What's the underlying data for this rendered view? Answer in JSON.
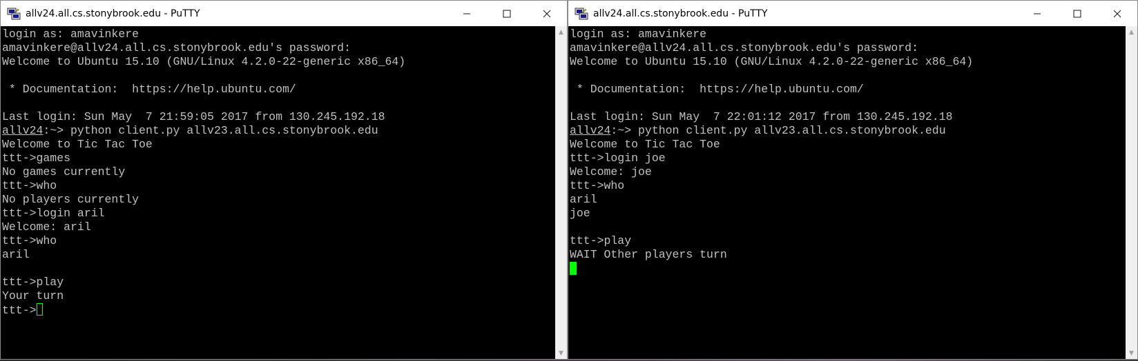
{
  "left_window": {
    "title": "allv24.all.cs.stonybrook.edu - PuTTY",
    "controls": {
      "minimize": "—",
      "maximize": "☐",
      "close": "✕"
    },
    "lines": [
      {
        "text": "login as: amavinkere"
      },
      {
        "text": "amavinkere@allv24.all.cs.stonybrook.edu's password:"
      },
      {
        "text": "Welcome to Ubuntu 15.10 (GNU/Linux 4.2.0-22-generic x86_64)"
      },
      {
        "text": ""
      },
      {
        "text": " * Documentation:  https://help.ubuntu.com/"
      },
      {
        "text": ""
      },
      {
        "text": "Last login: Sun May  7 21:59:05 2017 from 130.245.192.18"
      },
      {
        "host": "allv24",
        "text": ":~> python client.py allv23.all.cs.stonybrook.edu"
      },
      {
        "text": "Welcome to Tic Tac Toe"
      },
      {
        "text": "ttt->games"
      },
      {
        "text": "No games currently"
      },
      {
        "text": "ttt->who"
      },
      {
        "text": "No players currently"
      },
      {
        "text": "ttt->login aril"
      },
      {
        "text": "Welcome: aril"
      },
      {
        "text": "ttt->who"
      },
      {
        "text": "aril"
      },
      {
        "text": ""
      },
      {
        "text": "ttt->play"
      },
      {
        "text": "Your turn"
      },
      {
        "text": "ttt->",
        "cursor": "hollow"
      }
    ]
  },
  "right_window": {
    "title": "allv24.all.cs.stonybrook.edu - PuTTY",
    "controls": {
      "minimize": "—",
      "maximize": "☐",
      "close": "✕"
    },
    "lines": [
      {
        "text": "login as: amavinkere"
      },
      {
        "text": "amavinkere@allv24.all.cs.stonybrook.edu's password:"
      },
      {
        "text": "Welcome to Ubuntu 15.10 (GNU/Linux 4.2.0-22-generic x86_64)"
      },
      {
        "text": ""
      },
      {
        "text": " * Documentation:  https://help.ubuntu.com/"
      },
      {
        "text": ""
      },
      {
        "text": "Last login: Sun May  7 22:01:12 2017 from 130.245.192.18"
      },
      {
        "host": "allv24",
        "text": ":~> python client.py allv23.all.cs.stonybrook.edu"
      },
      {
        "text": "Welcome to Tic Tac Toe"
      },
      {
        "text": "ttt->login joe"
      },
      {
        "text": "Welcome: joe"
      },
      {
        "text": "ttt->who"
      },
      {
        "text": "aril"
      },
      {
        "text": "joe"
      },
      {
        "text": ""
      },
      {
        "text": "ttt->play"
      },
      {
        "text": "WAIT Other players turn"
      },
      {
        "text": "",
        "cursor": "solid"
      }
    ]
  },
  "colors": {
    "terminal_bg": "#000000",
    "terminal_fg": "#c0c0c0",
    "cursor": "#00ff00"
  },
  "icons": {
    "app": "putty-icon",
    "minimize": "minimize-icon",
    "maximize": "maximize-icon",
    "close": "close-icon",
    "scroll_up": "scroll-up-arrow-icon",
    "scroll_down": "scroll-down-arrow-icon"
  }
}
